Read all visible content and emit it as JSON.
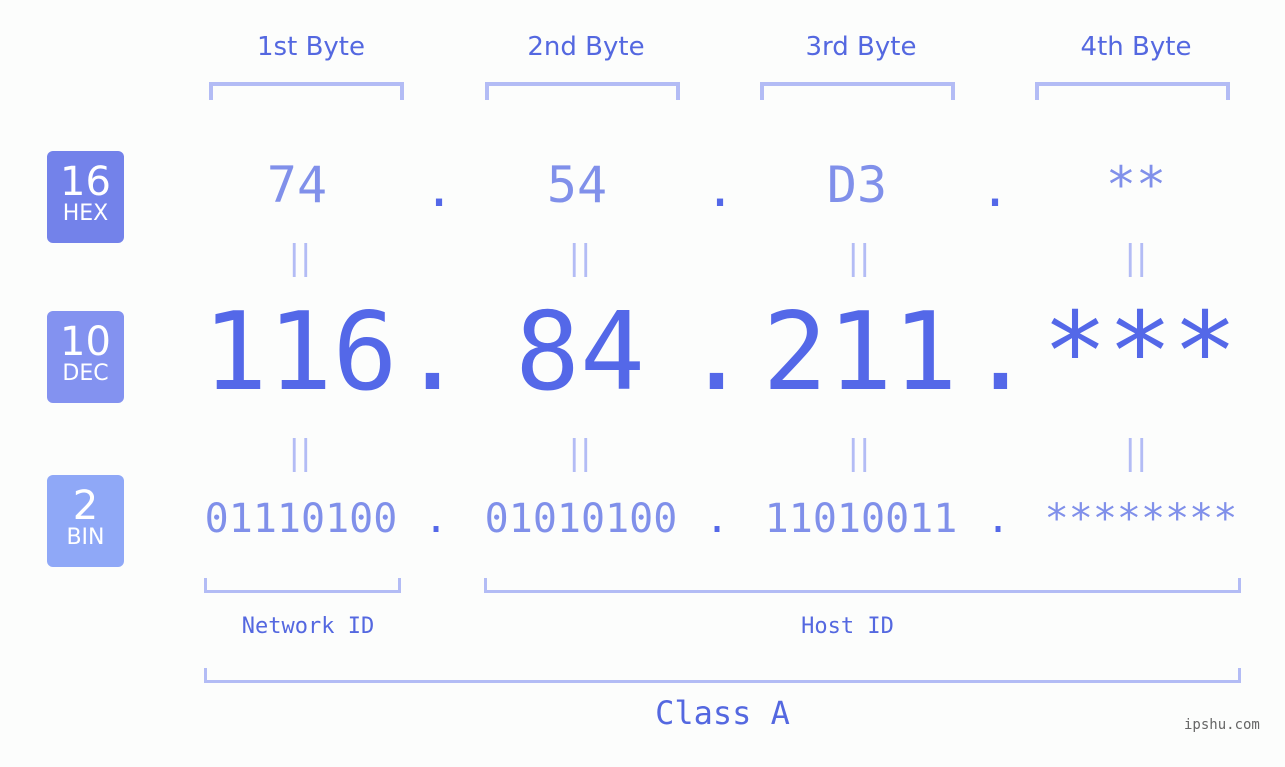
{
  "byte_headers": [
    "1st Byte",
    "2nd Byte",
    "3rd Byte",
    "4th Byte"
  ],
  "badges": [
    {
      "num": "16",
      "sub": "HEX",
      "color": "#7382ea"
    },
    {
      "num": "10",
      "sub": "DEC",
      "color": "#8392f0"
    },
    {
      "num": "2",
      "sub": "BIN",
      "color": "#8fa8f7"
    }
  ],
  "hex": [
    "74",
    "54",
    "D3",
    "**"
  ],
  "dec": [
    "116",
    "84",
    "211",
    "***"
  ],
  "bin": [
    "01110100",
    "01010100",
    "11010011",
    "********"
  ],
  "separator": ".",
  "equals": "||",
  "network_label": "Network ID",
  "host_label": "Host ID",
  "class_label": "Class A",
  "watermark": "ipshu.com"
}
